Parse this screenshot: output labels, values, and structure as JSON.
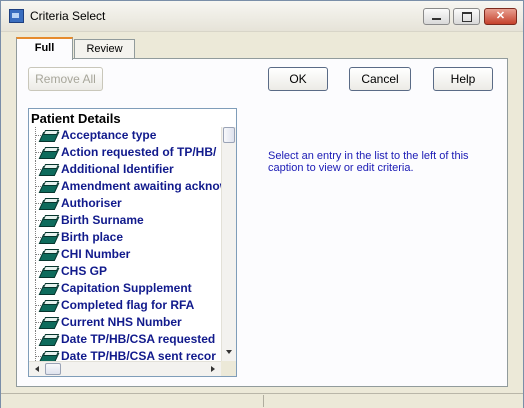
{
  "window": {
    "title": "Criteria Select"
  },
  "titlebar_buttons": {
    "minimize": "",
    "maximize": "",
    "close": "✕"
  },
  "tabs": [
    {
      "label": "Full",
      "active": true
    },
    {
      "label": "Review",
      "active": false
    }
  ],
  "buttons": {
    "remove_all": "Remove All",
    "ok": "OK",
    "cancel": "Cancel",
    "help": "Help"
  },
  "info_text": "Select an entry in the list to the left of this caption to view or edit criteria.",
  "tree": {
    "header": "Patient Details",
    "items": [
      "Acceptance type",
      "Action requested of TP/HB/",
      "Additional Identifier",
      "Amendment awaiting acknow",
      "Authoriser",
      "Birth Surname",
      "Birth place",
      "CHI Number",
      "CHS GP",
      "Capitation Supplement",
      "Completed flag for RFA",
      "Current NHS Number",
      "Date TP/HB/CSA requested",
      "Date TP/HB/CSA sent recor"
    ],
    "icon": "book-icon"
  },
  "colors": {
    "item_text": "#111a8c",
    "info_text": "#1b1bb5",
    "tab_highlight": "#e68b2c",
    "window_bg": "#ece9d8"
  }
}
